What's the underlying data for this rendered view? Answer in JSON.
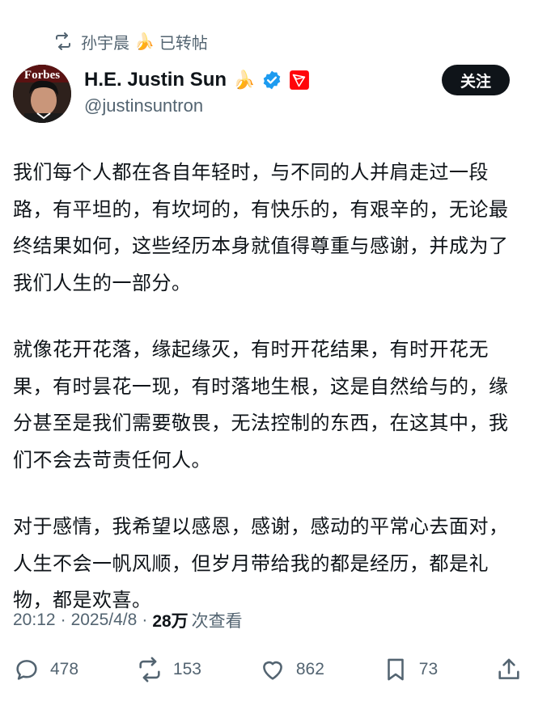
{
  "repost": {
    "user": "孙宇晨",
    "emoji": "🍌",
    "label": "已转帖"
  },
  "author": {
    "name": "H.E. Justin Sun",
    "emoji": "🍌",
    "handle": "@justinsuntron",
    "avatar_text": "Forbes",
    "verified": true
  },
  "follow_label": "关注",
  "post": {
    "paragraphs": [
      "我们每个人都在各自年轻时，与不同的人并肩走过一段路，有平坦的，有坎坷的，有快乐的，有艰辛的，无论最终结果如何，这些经历本身就值得尊重与感谢，并成为了我们人生的一部分。",
      "就像花开花落，缘起缘灭，有时开花结果，有时开花无果，有时昙花一现，有时落地生根，这是自然给与的，缘分甚至是我们需要敬畏，无法控制的东西，在这其中，我们不会去苛责任何人。",
      "对于感情，我希望以感恩，感谢，感动的平常心去面对，人生不会一帆风顺，但岁月带给我的都是经历，都是礼物，都是欢喜。"
    ]
  },
  "meta": {
    "time": "20:12",
    "date": "2025/4/8",
    "separator": "·",
    "views": "28万",
    "views_label": "次查看"
  },
  "actions": {
    "replies": "478",
    "reposts": "153",
    "likes": "862",
    "bookmarks": "73"
  },
  "colors": {
    "text": "#0f1419",
    "secondary": "#536471",
    "verified_blue": "#1d9bf0",
    "tron_red": "#ff060a"
  }
}
